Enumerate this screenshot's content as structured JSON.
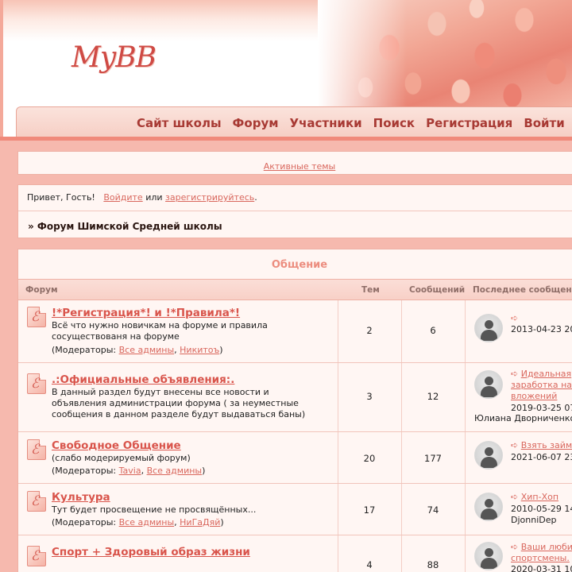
{
  "header": {
    "logo": "MyBB",
    "menu": [
      "Сайт школы",
      "Форум",
      "Участники",
      "Поиск",
      "Регистрация",
      "Войти"
    ]
  },
  "active_topics": "Активные темы",
  "welcome": {
    "greeting": "Привет, Гость!",
    "login": "Войдите",
    "or": "или",
    "register": "зарегистрируйтесь",
    "period": "."
  },
  "breadcrumb": "» Форум Шимской Средней школы",
  "category": {
    "title": "Общение",
    "columns": {
      "forum": "Форум",
      "topics": "Тем",
      "posts": "Сообщений",
      "last_post": "Последнее сообщение"
    }
  },
  "forums": [
    {
      "title": "!*Регистрация*! и !*Правила*!",
      "desc": "Всё что нужно новичкам на форуме и правила сосуществованя на форуме",
      "mods_label": "(Модераторы: ",
      "mods": [
        "Все админы",
        "Никитоъ"
      ],
      "mods_end": ")",
      "topics": "2",
      "posts": "6",
      "last_title": "",
      "last_date": "2013-04-23 20",
      "last_user": ""
    },
    {
      "title": ".:Официальные объявления:.",
      "desc": "В данный раздел будут внесены все новости и объявления администрации форума ( за неуместные сообщения в данном разделе будут выдаваться баны)",
      "mods_label": "",
      "mods": [],
      "mods_end": "",
      "topics": "3",
      "posts": "12",
      "last_title": "Идеальная заработка на вложений",
      "last_date": "2019-03-25 07",
      "last_user": "Юлиана Дворниченко"
    },
    {
      "title": "Свободное Общение",
      "desc": "(слабо модерируемый форум)",
      "mods_label": "(Модераторы: ",
      "mods": [
        "Tavia",
        "Все админы"
      ],
      "mods_end": ")",
      "topics": "20",
      "posts": "177",
      "last_title": "Взять займ",
      "last_date": "2021-06-07 23",
      "last_user": ""
    },
    {
      "title": "Культура",
      "desc": "Тут будет просвещение не просвящённых...",
      "mods_label": "(Модераторы: ",
      "mods": [
        "Все админы",
        "НиГаДяй"
      ],
      "mods_end": ")",
      "topics": "17",
      "posts": "74",
      "last_title": "Хип-Хоп",
      "last_date": "2010-05-29 14",
      "last_user": "DjonniDep"
    },
    {
      "title": "Спорт + Здоровый образ жизни",
      "desc": "",
      "mods_label": "",
      "mods": [],
      "mods_end": "",
      "topics": "4",
      "posts": "88",
      "last_title": "Ваши люби спортсмены.",
      "last_date": "2020-03-31 10",
      "last_user": ""
    }
  ],
  "separators": {
    "comma": ", "
  },
  "arrow": "➪",
  "colors": {
    "accent": "#d9554c",
    "link": "#d9675d",
    "header_band": "#f08a7b",
    "background": "#f6b9ae"
  },
  "icons": [
    "forum-icon",
    "avatar-icon",
    "arrow-icon"
  ]
}
